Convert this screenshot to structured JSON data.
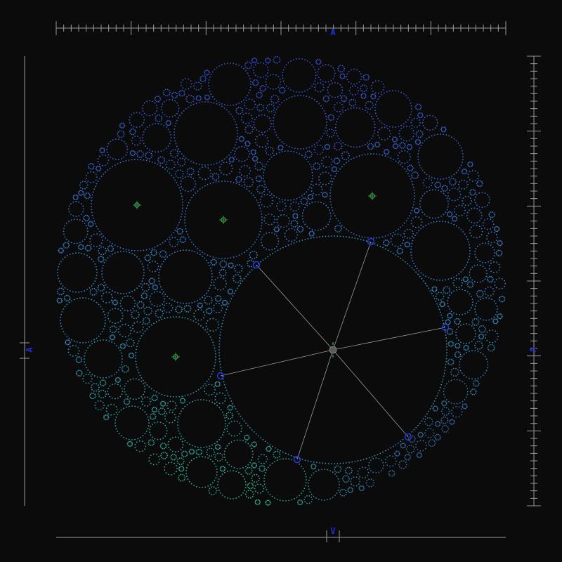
{
  "axes": {
    "top": "A",
    "bottom": "V",
    "left": "A",
    "right": "V"
  },
  "colors": {
    "background": "#0b0b0b",
    "ruler": "#9a9a9a",
    "axis_letter": "#1d2fd8",
    "dot_top": "#3a4fd6",
    "dot_mid": "#3c86c9",
    "dot_bottom": "#2fb38f",
    "dot_bottom_right": "#3a3fb0",
    "spoke": "#9a9a9a",
    "center_marker": "#5a5a5a",
    "spoke_handle": "#2a36e0",
    "crosshair": "#3bb54a"
  },
  "icons": {
    "spoke_handle": "open-circle-handle",
    "center_marker": "filled-circle-center",
    "crosshair": "circle-crosshair"
  }
}
